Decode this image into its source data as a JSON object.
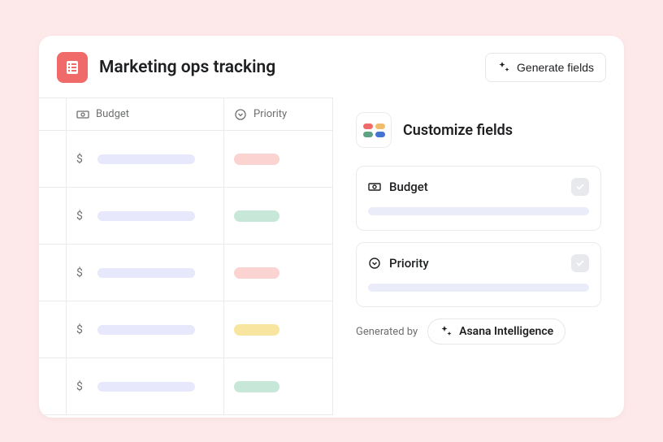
{
  "header": {
    "project_title": "Marketing ops tracking",
    "generate_button_label": "Generate fields"
  },
  "table": {
    "columns": {
      "budget": {
        "label": "Budget",
        "icon": "money-icon"
      },
      "priority": {
        "label": "Priority",
        "icon": "chevron-circle-icon"
      }
    },
    "rows": [
      {
        "currency": "$",
        "priority_color": "red"
      },
      {
        "currency": "$",
        "priority_color": "green"
      },
      {
        "currency": "$",
        "priority_color": "red"
      },
      {
        "currency": "$",
        "priority_color": "yellow"
      },
      {
        "currency": "$",
        "priority_color": "green"
      }
    ]
  },
  "panel": {
    "customize_title": "Customize fields",
    "fields": [
      {
        "label": "Budget",
        "icon": "money-icon",
        "checked": true
      },
      {
        "label": "Priority",
        "icon": "chevron-circle-icon",
        "checked": true
      }
    ],
    "generated_by_label": "Generated by",
    "ai_badge_label": "Asana Intelligence"
  }
}
